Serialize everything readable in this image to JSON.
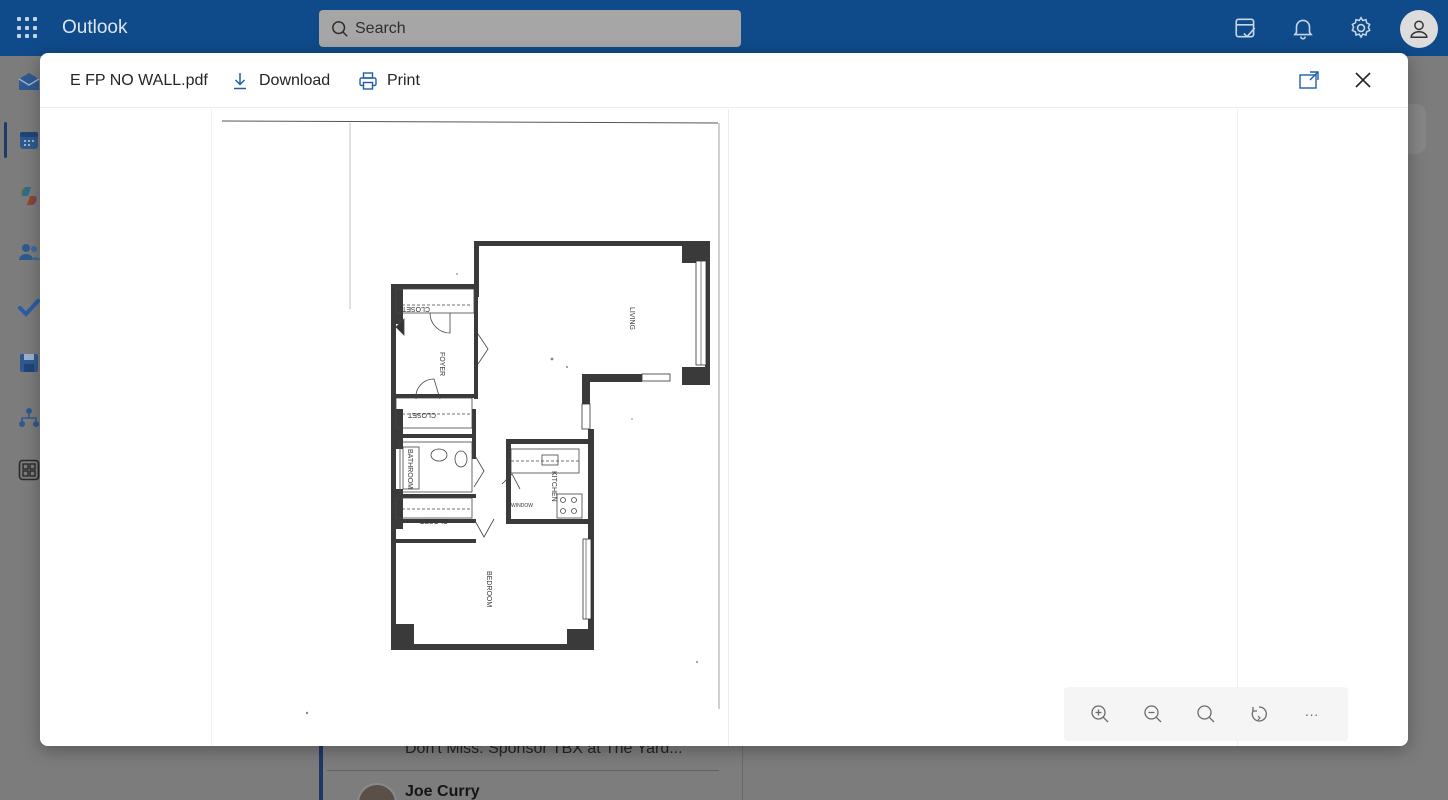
{
  "app": {
    "name": "Outlook"
  },
  "search": {
    "label": "Search"
  },
  "modal": {
    "file_name": "E FP NO WALL.pdf",
    "download_label": "Download",
    "print_label": "Print"
  },
  "floorplan": {
    "rooms": {
      "living": "LIVING",
      "foyer": "FOYER",
      "closet_top": "CLOSET",
      "closet_mid": "CLOSET",
      "closet_low": "CLOSET",
      "bathroom": "BATHROOM",
      "kitchen": "KITCHEN",
      "bedroom": "BEDROOM",
      "window": "WINDOW"
    }
  },
  "zoom_toolbar": {
    "more_label": "···"
  },
  "mail": {
    "snippet": "Don't Miss: Sponsor TBX at The Yard...",
    "sender": "Joe Curry"
  },
  "colors": {
    "top_bar": "#0f4a8a",
    "overlay": "#7c7c7c",
    "modal_bg": "#ffffff"
  }
}
